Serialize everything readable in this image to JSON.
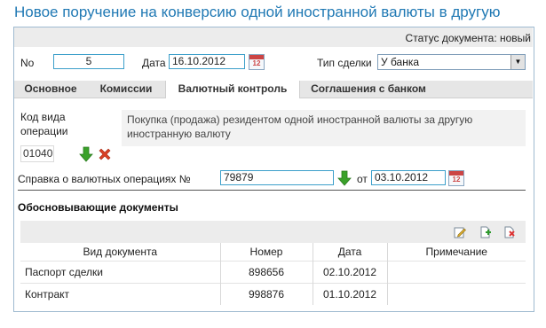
{
  "page": {
    "title": "Новое поручение на конверсию одной иностранной валюты в другую"
  },
  "status": {
    "text": "Статус документа: новый"
  },
  "header": {
    "no_label": "No",
    "no_value": "5",
    "date_label": "Дата",
    "date_value": "16.10.2012",
    "deal_type_label": "Тип сделки",
    "deal_type_value": "У банка",
    "calendar_day": "12"
  },
  "tabs": [
    {
      "label": "Основное"
    },
    {
      "label": "Комиссии"
    },
    {
      "label": "Валютный контроль",
      "active": true
    },
    {
      "label": "Соглашения с банком"
    }
  ],
  "currency_control": {
    "op_code_label_1": "Код вида",
    "op_code_label_2": "операции",
    "op_code_value": "01040",
    "op_description": "Покупка (продажа) резидентом одной иностранной валюты за другую иностранную валюту",
    "cert_label": "Справка о валютных операциях №",
    "cert_number": "79879",
    "cert_from_label": "от",
    "cert_date": "03.10.2012"
  },
  "documents": {
    "section_title": "Обосновывающие документы",
    "columns": [
      "Вид документа",
      "Номер",
      "Дата",
      "Примечание"
    ],
    "rows": [
      {
        "type": "Паспорт сделки",
        "number": "898656",
        "date": "02.10.2012",
        "note": ""
      },
      {
        "type": "Контракт",
        "number": "998876",
        "date": "01.10.2012",
        "note": ""
      }
    ],
    "toolbar": {
      "edit_icon": "edit-icon",
      "add_icon": "add-document-icon",
      "delete_icon": "delete-document-icon"
    }
  },
  "colors": {
    "title": "#2079b4",
    "input_border": "#3c9fca",
    "arrow_green": "#3aa12a",
    "cross_red": "#d94025"
  }
}
